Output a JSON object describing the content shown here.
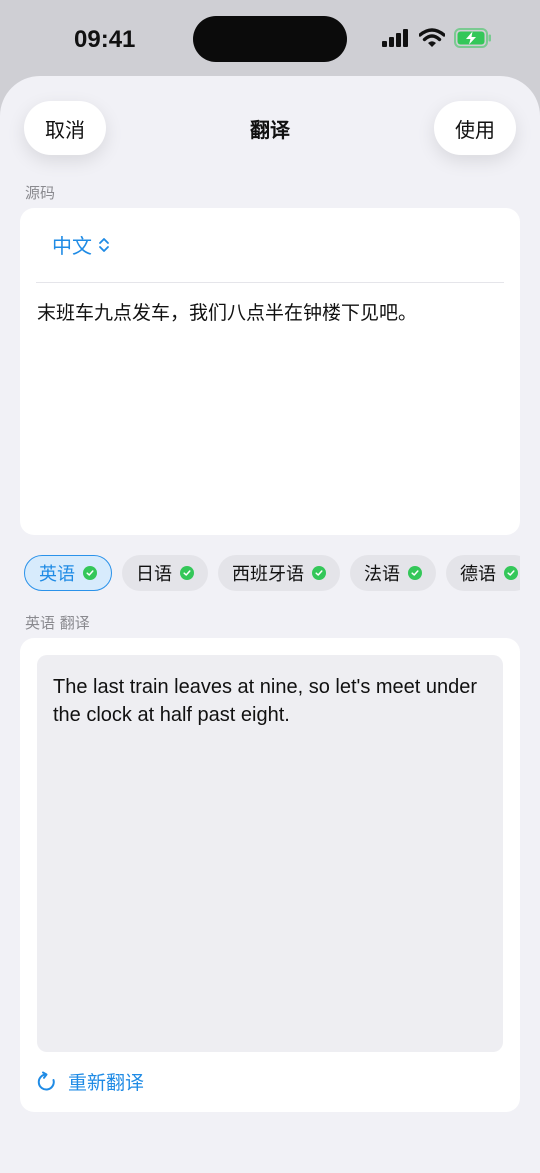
{
  "status": {
    "time": "09:41"
  },
  "nav": {
    "cancel": "取消",
    "title": "翻译",
    "use": "使用"
  },
  "source": {
    "section_label": "源码",
    "language": "中文",
    "text": "末班车九点发车，我们八点半在钟楼下见吧。"
  },
  "targets": [
    {
      "label": "英语",
      "active": true
    },
    {
      "label": "日语",
      "active": false
    },
    {
      "label": "西班牙语",
      "active": false
    },
    {
      "label": "法语",
      "active": false
    },
    {
      "label": "德语",
      "active": false
    }
  ],
  "result": {
    "section_label": "英语 翻译",
    "text": "The last train leaves at nine, so let's meet under the clock at half past eight.",
    "retranslate": "重新翻译"
  },
  "colors": {
    "accent": "#1f8be5",
    "check": "#34c759",
    "battery": "#34c759"
  },
  "icons": [
    "signal-icon",
    "wifi-icon",
    "battery-charging-icon",
    "chevron-updown-icon",
    "checkmark-icon",
    "refresh-icon"
  ]
}
